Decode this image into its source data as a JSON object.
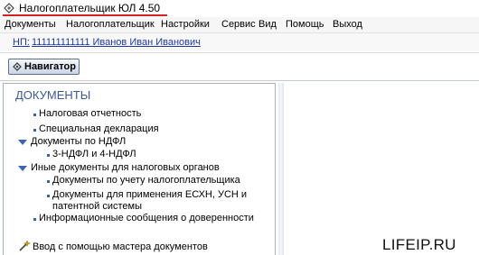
{
  "window": {
    "title": "Налогоплательщик ЮЛ 4.50"
  },
  "menu": [
    "Документы",
    "Налогоплательщик",
    "Настройки",
    "Сервис",
    "Вид",
    "Помощь",
    "Выход"
  ],
  "taxpayer": {
    "label": "НП:",
    "value": "111111111111 Иванов Иван Иванович"
  },
  "toolbar": {
    "navigator_label": "Навигатор"
  },
  "panel": {
    "heading": "ДОКУМЕНТЫ",
    "items": [
      {
        "text": "Налоговая отчетность",
        "type": "leaf"
      },
      {
        "text": "Специальная декларация",
        "type": "leaf"
      },
      {
        "text": "Документы по НДФЛ",
        "type": "group"
      },
      {
        "text": "3-НДФЛ и 4-НДФЛ",
        "type": "leaf"
      },
      {
        "text": "Иные документы для налоговых органов",
        "type": "group"
      },
      {
        "text": "Документы по учету налогоплательщика",
        "type": "leaf"
      },
      {
        "text": "Документы для применения ЕСХН, УСН и",
        "type": "leaf"
      },
      {
        "text": "патентной системы",
        "type": "continuation"
      },
      {
        "text": "Информационные сообщения о доверенности",
        "type": "leaf"
      }
    ],
    "wizard_label": "Ввод с помощью мастера документов"
  },
  "watermark": "LIFEIP.RU",
  "colors": {
    "title_underline": "#d72020",
    "heading": "#3a5a9a",
    "link": "#1f3aa0",
    "bullet": "#3b5fb5"
  }
}
